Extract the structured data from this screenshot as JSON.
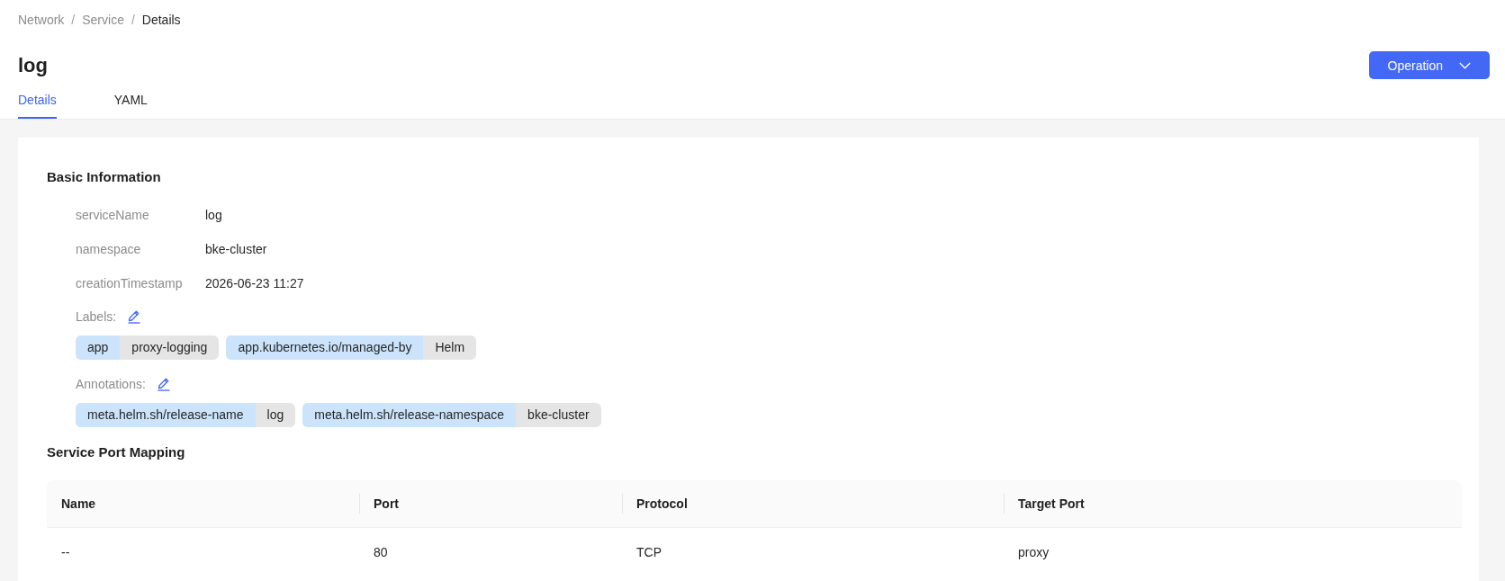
{
  "breadcrumb": {
    "items": [
      {
        "label": "Network",
        "current": false
      },
      {
        "label": "Service",
        "current": false
      },
      {
        "label": "Details",
        "current": true
      }
    ],
    "separators": [
      "/",
      "/"
    ]
  },
  "title": "log",
  "operation_button": {
    "label": "Operation"
  },
  "tabs": [
    {
      "label": "Details",
      "selected": true
    },
    {
      "label": "YAML",
      "selected": false
    }
  ],
  "basic_information": {
    "heading": "Basic Information",
    "fields": [
      {
        "label": "serviceName",
        "value": "log"
      },
      {
        "label": "namespace",
        "value": "bke-cluster"
      },
      {
        "label": "creationTimestamp",
        "value": "2026-06-23 11:27"
      }
    ],
    "labels": {
      "caption": "Labels:",
      "tags": [
        {
          "key": "app",
          "value": "proxy-logging"
        },
        {
          "key": "app.kubernetes.io/managed-by",
          "value": "Helm"
        }
      ]
    },
    "annotations": {
      "caption": "Annotations:",
      "tags": [
        {
          "key": "meta.helm.sh/release-name",
          "value": "log"
        },
        {
          "key": "meta.helm.sh/release-namespace",
          "value": "bke-cluster"
        }
      ]
    }
  },
  "service_port_mapping": {
    "heading": "Service Port Mapping",
    "columns": [
      "Name",
      "Port",
      "Protocol",
      "Target Port"
    ],
    "rows": [
      [
        "--",
        "80",
        "TCP",
        "proxy"
      ]
    ]
  }
}
